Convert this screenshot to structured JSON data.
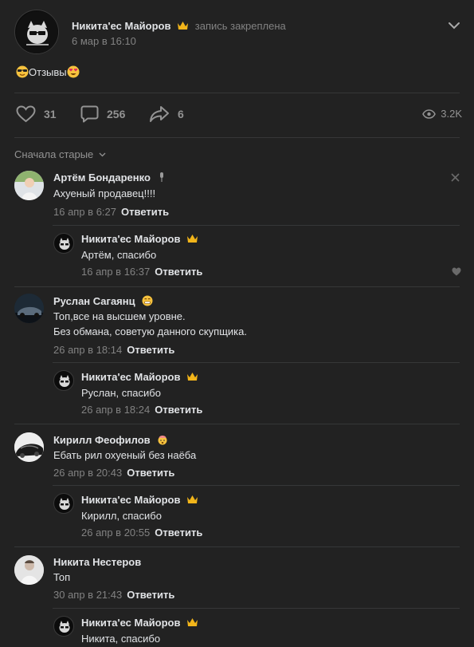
{
  "post": {
    "author": "Никита'ес Майоров",
    "pinned_label": "запись закреплена",
    "date": "6 мар в 16:10",
    "text": "Отзывы",
    "likes": "31",
    "comments": "256",
    "shares": "6",
    "views": "3.2K"
  },
  "sort_label": "Сначала старые",
  "reply_label": "Ответить",
  "comments": [
    {
      "author": "Артём Бондаренко",
      "lines": [
        "Ахуеный продавец!!!!"
      ],
      "date": "16 апр в 6:27",
      "reply": {
        "author": "Никита'ес Майоров",
        "text": "Артём, спасибо",
        "date": "16 апр в 16:37"
      }
    },
    {
      "author": "Руслан Сагаянц",
      "lines": [
        "Топ,все на высшем уровне.",
        "Без обмана, советую данного скупщика."
      ],
      "date": "26 апр в 18:14",
      "reply": {
        "author": "Никита'ес Майоров",
        "text": "Руслан, спасибо",
        "date": "26 апр в 18:24"
      }
    },
    {
      "author": "Кирилл Феофилов",
      "lines": [
        "Ебать рил охуеный без наёба"
      ],
      "date": "26 апр в 20:43",
      "reply": {
        "author": "Никита'ес Майоров",
        "text": "Кирилл, спасибо",
        "date": "26 апр в 20:55"
      }
    },
    {
      "author": "Никита Нестеров",
      "lines": [
        "Топ"
      ],
      "date": "30 апр в 21:43",
      "reply": {
        "author": "Никита'ес Майоров",
        "text": "Никита, спасибо",
        "date": ""
      }
    }
  ],
  "colors": {
    "background": "#222222",
    "text": "#e1e3e6",
    "muted": "#828282",
    "divider": "#363738",
    "crown": "#f2b51a"
  }
}
